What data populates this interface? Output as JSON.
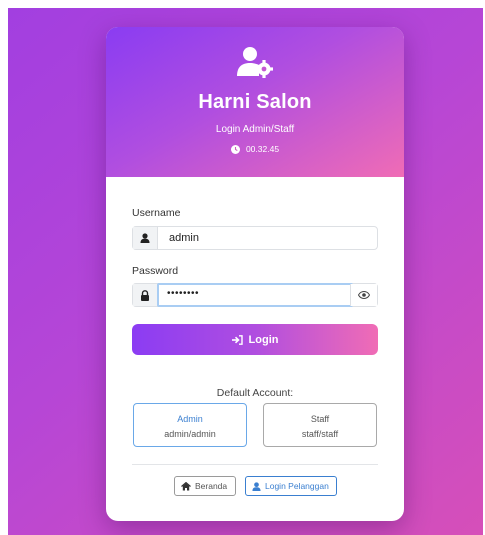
{
  "header": {
    "title": "Harni Salon",
    "subtitle": "Login Admin/Staff",
    "clock": "00.32.45"
  },
  "form": {
    "username_label": "Username",
    "username_value": "admin",
    "password_label": "Password",
    "password_masked": "••••••••",
    "login_label": "Login"
  },
  "default_accounts": {
    "title": "Default Account:",
    "items": [
      {
        "name": "Admin",
        "credentials": "admin/admin"
      },
      {
        "name": "Staff",
        "credentials": "staff/staff"
      }
    ]
  },
  "footer": {
    "home_label": "Beranda",
    "customer_login_label": "Login Pelanggan"
  },
  "colors": {
    "background": "#b646d6",
    "accent_start": "#8a3cf2",
    "accent_end": "#f06cb5",
    "link_blue": "#3a7fd0"
  },
  "icons": [
    "user-gear-icon",
    "clock-icon",
    "user-icon",
    "lock-icon",
    "eye-icon",
    "sign-in-icon",
    "home-icon",
    "user-icon"
  ]
}
